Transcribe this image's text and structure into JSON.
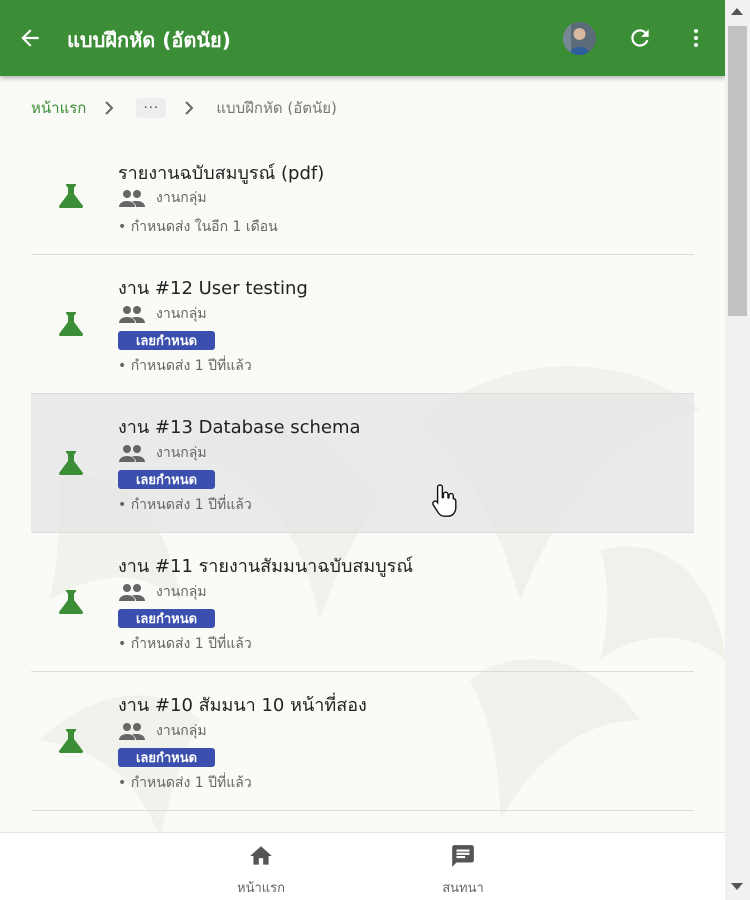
{
  "header": {
    "title": "แบบฝึกหัด (อัตนัย)",
    "back_icon": "arrow-left-icon",
    "refresh_icon": "refresh-icon",
    "more_icon": "more-vert-icon",
    "color": "#3b8d36"
  },
  "breadcrumb": {
    "home": "หน้าแรก",
    "more": "···",
    "current": "แบบฝึกหัด (อัตนัย)"
  },
  "assignments": [
    {
      "title": "รายงานฉบับสมบูรณ์ (pdf)",
      "type": "งานกลุ่ม",
      "badge": "",
      "due": "• กำหนดส่ง ในอีก 1 เดือน"
    },
    {
      "title": "งาน #12 User testing",
      "type": "งานกลุ่ม",
      "badge": "เลยกำหนด",
      "due": "• กำหนดส่ง 1 ปีที่แล้ว"
    },
    {
      "title": "งาน #13 Database schema",
      "type": "งานกลุ่ม",
      "badge": "เลยกำหนด",
      "due": "• กำหนดส่ง 1 ปีที่แล้ว"
    },
    {
      "title": "งาน #11 รายงานสัมมนาฉบับสมบูรณ์",
      "type": "งานกลุ่ม",
      "badge": "เลยกำหนด",
      "due": "• กำหนดส่ง 1 ปีที่แล้ว"
    },
    {
      "title": "งาน #10 สัมมนา 10 หน้าที่สอง",
      "type": "งานกลุ่ม",
      "badge": "เลยกำหนด",
      "due": "• กำหนดส่ง 1 ปีที่แล้ว"
    }
  ],
  "colors": {
    "flask": "#3b8d36",
    "overdue_badge": "#3a4fae"
  },
  "bottom_nav": {
    "home": "หน้าแรก",
    "chat": "สนทนา"
  }
}
